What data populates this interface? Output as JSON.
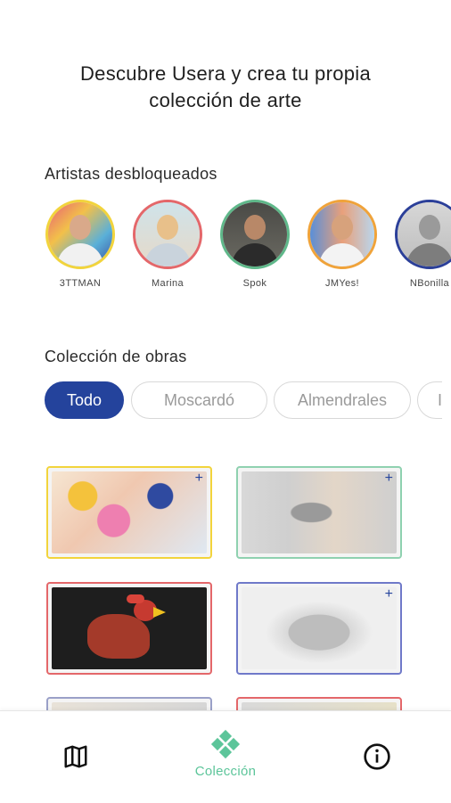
{
  "header": {
    "title_line1": "Descubre Usera y crea tu propia",
    "title_line2": "colección de arte"
  },
  "artists_section": {
    "label": "Artistas desbloqueados",
    "artists": [
      {
        "name": "3TTMAN",
        "border_color": "#f2d43c"
      },
      {
        "name": "Marina",
        "border_color": "#e4676a"
      },
      {
        "name": "Spok",
        "border_color": "#5fb88a"
      },
      {
        "name": "JMYes!",
        "border_color": "#f0a33a"
      },
      {
        "name": "NBonilla",
        "border_color": "#2b3f99"
      }
    ]
  },
  "collection_section": {
    "label": "Colección de obras",
    "filters": [
      "Todo",
      "Moscardó",
      "Almendrales",
      "I"
    ],
    "active_filter": "Todo"
  },
  "artworks": [
    {
      "name": "artwork-colorful-mural",
      "border_color": "#f2d43c",
      "plus": "+"
    },
    {
      "name": "artwork-building-mural",
      "border_color": "#8fd1b0",
      "plus": "+"
    },
    {
      "name": "artwork-rooster-sculpture",
      "border_color": "#e4676a",
      "plus": ""
    },
    {
      "name": "artwork-stone-sculpture",
      "border_color": "#6f79c9",
      "plus": "+"
    },
    {
      "name": "artwork-partial-1",
      "border_color": "#9aa0c8",
      "plus": ""
    },
    {
      "name": "artwork-partial-2",
      "border_color": "#e4676a",
      "plus": ""
    }
  ],
  "bottom_nav": {
    "map_icon": "map-icon",
    "collection_label": "Colección",
    "collection_icon": "diamond-cluster-icon",
    "info_icon": "info-icon",
    "accent": "#5cc59a"
  }
}
